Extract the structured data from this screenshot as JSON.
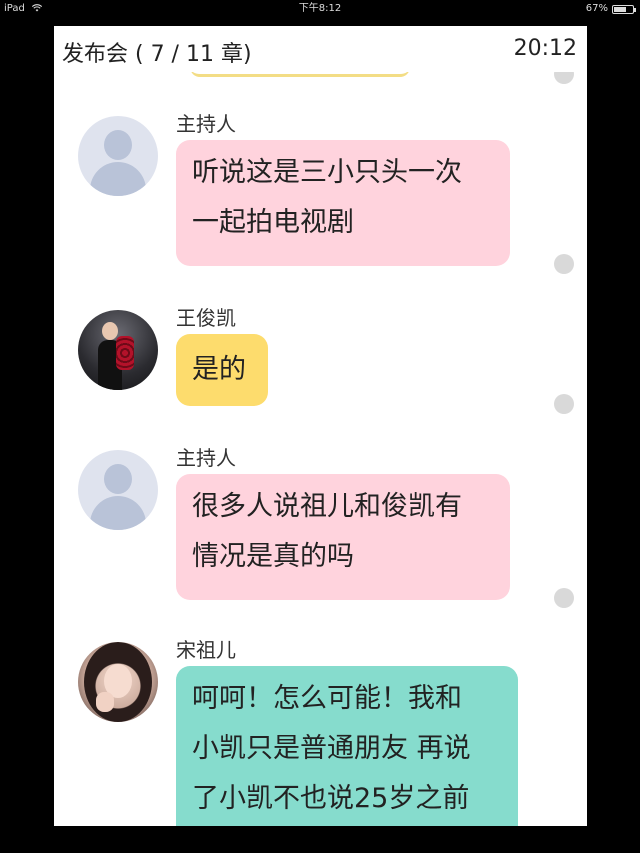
{
  "status_bar": {
    "device": "iPad",
    "time": "下午8:12",
    "battery": "67%",
    "battery_level": 0.67
  },
  "header": {
    "title": "发布会 ( 7 / 11 章)",
    "time": "20:12"
  },
  "messages": [
    {
      "speaker": "主持人",
      "avatar": "default-person-avatar",
      "bubble_color": "#ffd3dd",
      "lines": [
        "听说这是三小只头一次",
        "一起拍电视剧"
      ]
    },
    {
      "speaker": "王俊凯",
      "avatar": "photo-avatar-man-with-roses",
      "bubble_color": "#fddc6d",
      "lines": [
        "是的"
      ]
    },
    {
      "speaker": "主持人",
      "avatar": "default-person-avatar",
      "bubble_color": "#ffd3dd",
      "lines": [
        "很多人说祖儿和俊凯有",
        "情况是真的吗"
      ]
    },
    {
      "speaker": "宋祖儿",
      "avatar": "photo-avatar-girl",
      "bubble_color": "#86dccd",
      "lines": [
        "呵呵！怎么可能！我和",
        "小凯只是普通朋友 再说",
        "了小凯不也说25岁之前"
      ]
    }
  ]
}
